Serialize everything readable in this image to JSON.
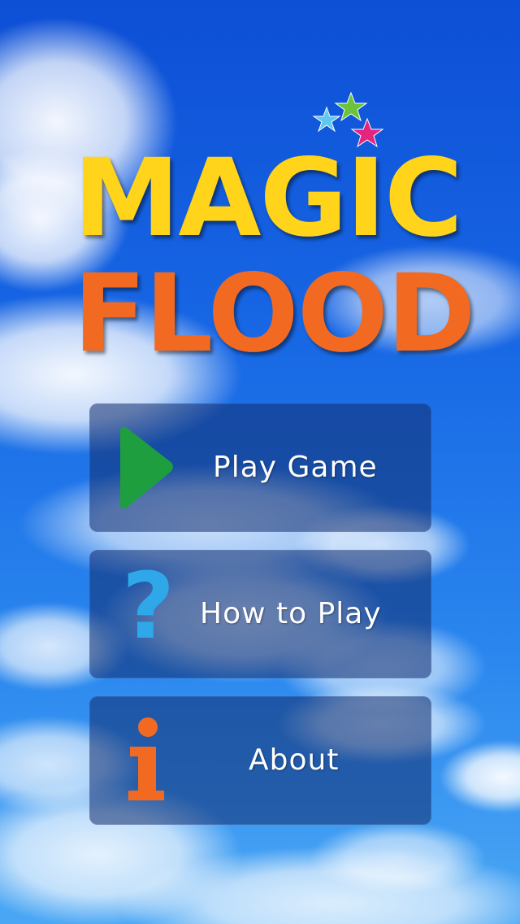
{
  "app": {
    "title_line1": "MAGIC",
    "title_line2": "FLOOD"
  },
  "menu": {
    "play": {
      "label": "Play Game",
      "icon": "play-icon"
    },
    "how": {
      "label": "How to Play",
      "icon": "question-mark-icon",
      "glyph": "?"
    },
    "about": {
      "label": "About",
      "icon": "info-icon"
    }
  },
  "colors": {
    "title_yellow": "#ffd41a",
    "title_orange": "#f26a22",
    "play_green": "#1f9e3f",
    "question_blue": "#2ea8e8",
    "info_orange": "#f26a22",
    "sky_blue": "#1766e4"
  }
}
